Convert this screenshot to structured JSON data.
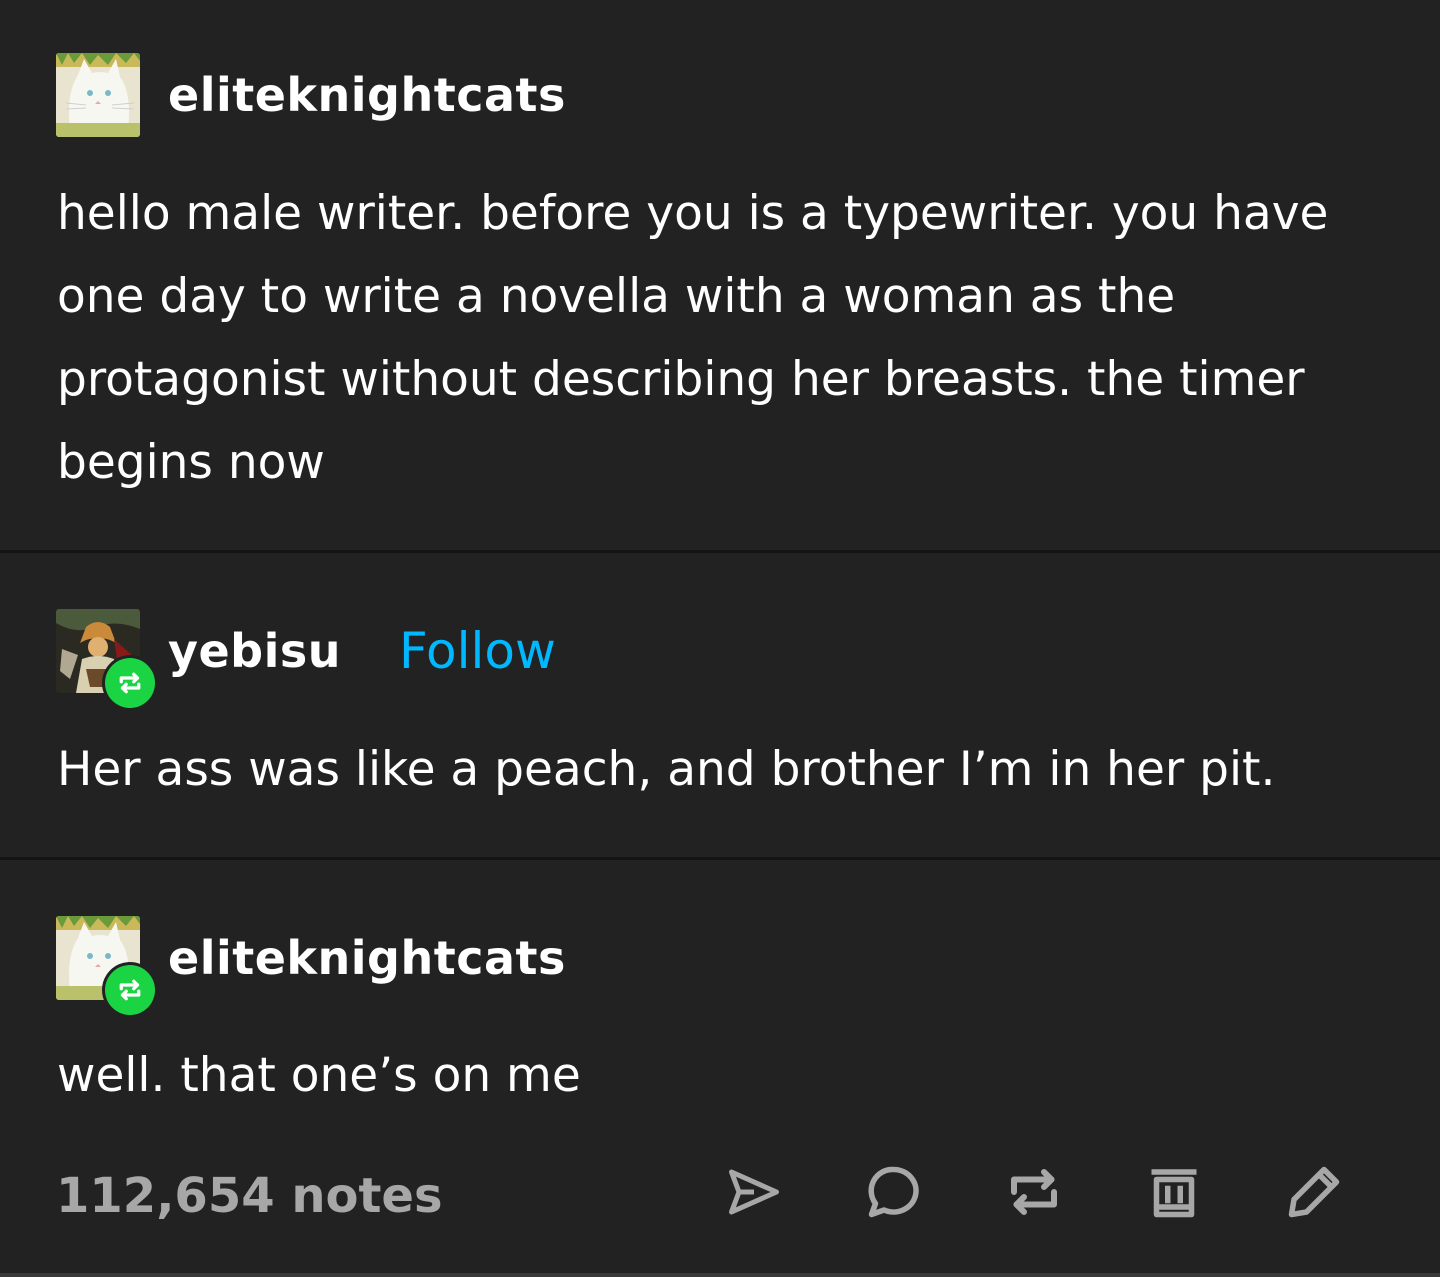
{
  "posts": [
    {
      "username": "eliteknightcats",
      "avatar_icon": "white-cat-avatar",
      "reblog": false,
      "follow_label": "",
      "text": "hello male writer. before you is a typewriter. you have one day to write a novella with a woman as the protagonist without describing her breasts. the timer begins now"
    },
    {
      "username": "yebisu",
      "avatar_icon": "illustrated-figure-avatar",
      "reblog": true,
      "follow_label": "Follow",
      "text": "Her ass was like a peach, and brother I’m in her pit."
    },
    {
      "username": "eliteknightcats",
      "avatar_icon": "white-cat-avatar",
      "reblog": true,
      "follow_label": "",
      "text": "well. that one’s on me"
    }
  ],
  "footer": {
    "notes": "112,654 notes",
    "actions": [
      "share-icon",
      "comment-icon",
      "reblog-icon",
      "delete-icon",
      "edit-icon"
    ]
  },
  "colors": {
    "background": "#222222",
    "text": "#ffffff",
    "follow": "#00b8ff",
    "reblog_badge": "#1bd444",
    "muted": "#a7a7a7"
  }
}
